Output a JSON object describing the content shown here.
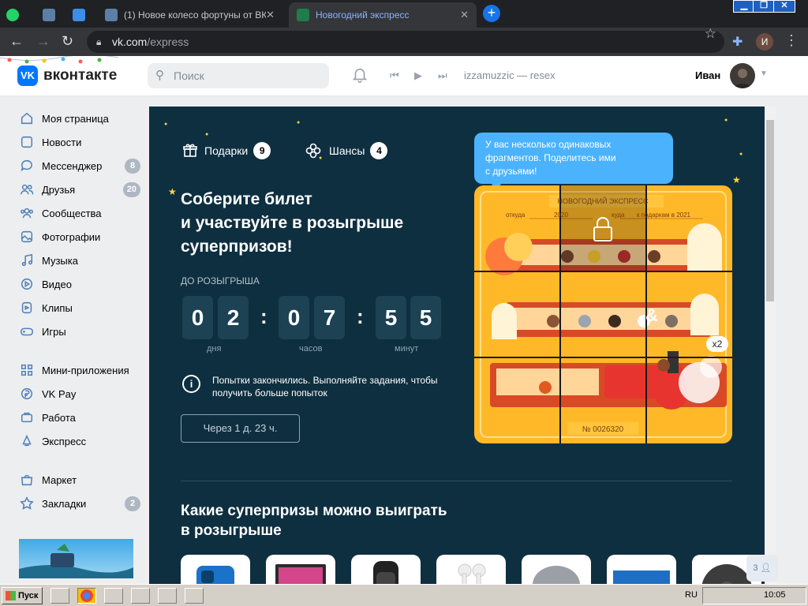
{
  "browser": {
    "tabs": [
      {
        "title": "",
        "icon": "whatsapp-icon"
      },
      {
        "title": "",
        "icon": "vk-icon"
      },
      {
        "title": "",
        "icon": "tool-icon"
      },
      {
        "title": "(1) Новое колесо фортуны от ВК |",
        "icon": "vk-icon"
      },
      {
        "title": "Новогодний экспресс",
        "icon": "tree-icon",
        "active": true
      }
    ],
    "url_host": "vk.com",
    "url_path": "/express",
    "profile_letter": "И"
  },
  "header": {
    "logo": "вконтакте",
    "search_placeholder": "Поиск",
    "now_playing": "izzamuzzic — resex",
    "user_name": "Иван"
  },
  "sidebar": {
    "items": [
      {
        "label": "Моя страница",
        "icon": "home-icon"
      },
      {
        "label": "Новости",
        "icon": "news-icon"
      },
      {
        "label": "Мессенджер",
        "icon": "chat-icon",
        "count": "8"
      },
      {
        "label": "Друзья",
        "icon": "friends-icon",
        "count": "20"
      },
      {
        "label": "Сообщества",
        "icon": "groups-icon"
      },
      {
        "label": "Фотографии",
        "icon": "photo-icon"
      },
      {
        "label": "Музыка",
        "icon": "music-icon"
      },
      {
        "label": "Видео",
        "icon": "video-icon"
      },
      {
        "label": "Клипы",
        "icon": "clips-icon"
      },
      {
        "label": "Игры",
        "icon": "games-icon"
      },
      {
        "label": "Мини-приложения",
        "icon": "apps-icon"
      },
      {
        "label": "VK Pay",
        "icon": "pay-icon"
      },
      {
        "label": "Работа",
        "icon": "work-icon"
      },
      {
        "label": "Экспресс",
        "icon": "express-icon"
      },
      {
        "label": "Маркет",
        "icon": "market-icon"
      },
      {
        "label": "Закладки",
        "icon": "bookmark-icon",
        "count": "2"
      }
    ]
  },
  "express": {
    "gifts_label": "Подарки",
    "gifts_count": "9",
    "chances_label": "Шансы",
    "chances_count": "4",
    "headline": [
      "Соберите билет",
      "и участвуйте в розыгрыше",
      "суперпризов!"
    ],
    "until_label": "ДО РОЗЫГРЫША",
    "digits": [
      "0",
      "2",
      "0",
      "7",
      "5",
      "5"
    ],
    "units": [
      "дня",
      "часов",
      "минут"
    ],
    "info_text": "Попытки закончились. Выполняйте задания, чтобы получить больше попыток",
    "wait_button": "Через 1 д. 23 ч.",
    "tooltip": [
      "У вас несколько одинаковых",
      "фрагментов. Поделитесь ими",
      "с друзьями!"
    ],
    "ticket": {
      "title": "НОВОГОДНИЙ ЭКСПРЕСС",
      "from_label": "откуда",
      "from_value": "2020",
      "to_label": "куда",
      "to_value": "к подаркам в 2021",
      "number": "№ 0026320"
    },
    "duplicate_badge": "x2",
    "prizes_title": [
      "Какие суперпризы можно выиграть",
      "в розыгрыше"
    ]
  },
  "floating": {
    "label": "3"
  },
  "taskbar": {
    "start": "Пуск",
    "lang": "RU",
    "time": "10:05"
  },
  "colors": {
    "panel": "#0e2f40",
    "accent": "#0077ff",
    "ticket": "#ffb928",
    "tooltip": "#4bb3fd"
  }
}
